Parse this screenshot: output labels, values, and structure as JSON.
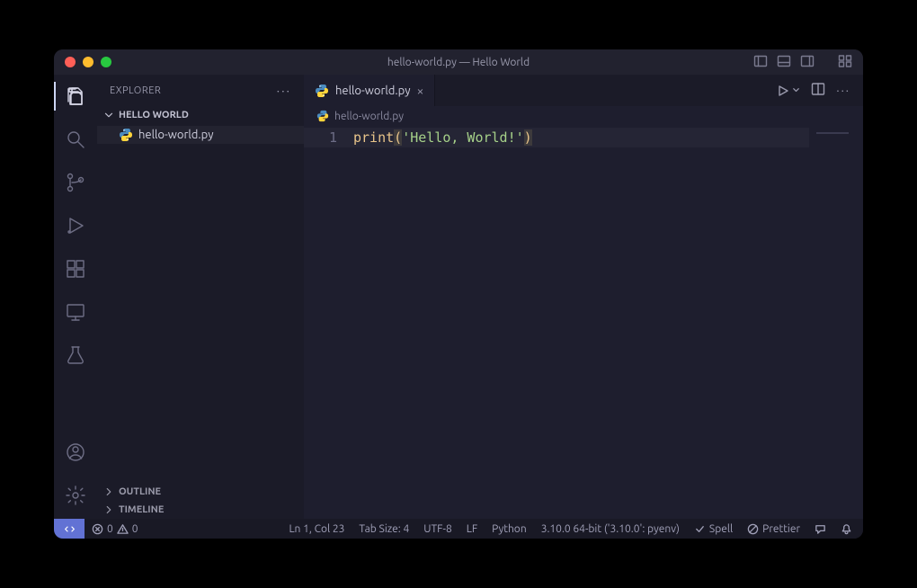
{
  "titlebar": {
    "title": "hello-world.py — Hello World"
  },
  "activity": {
    "items": [
      "explorer",
      "search",
      "source-control",
      "run-debug",
      "extensions",
      "remote-explorer",
      "testing"
    ],
    "bottom": [
      "accounts",
      "settings"
    ]
  },
  "sidebar": {
    "title": "EXPLORER",
    "folder_name": "HELLO WORLD",
    "files": [
      {
        "name": "hello-world.py",
        "icon": "python"
      }
    ],
    "sections": [
      "OUTLINE",
      "TIMELINE"
    ]
  },
  "tabs": {
    "open": [
      {
        "name": "hello-world.py",
        "icon": "python"
      }
    ]
  },
  "breadcrumbs": {
    "path": "hello-world.py"
  },
  "code": {
    "line_number": "1",
    "tokens": {
      "fn": "print",
      "lpar": "(",
      "str": "'Hello, World!'",
      "rpar": ")"
    }
  },
  "status": {
    "errors": "0",
    "warnings": "0",
    "cursor": "Ln 1, Col 23",
    "tab_size": "Tab Size: 4",
    "encoding": "UTF-8",
    "eol": "LF",
    "language": "Python",
    "interpreter": "3.10.0 64-bit ('3.10.0': pyenv)",
    "spell": "Spell",
    "prettier": "Prettier"
  }
}
